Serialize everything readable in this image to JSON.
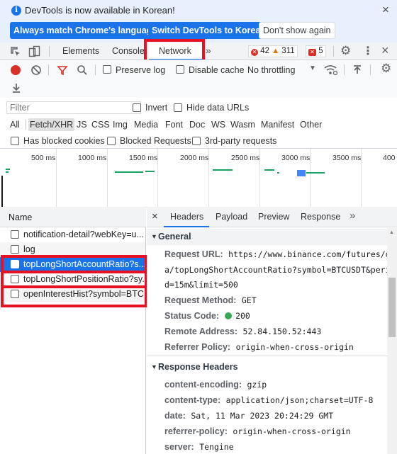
{
  "infobar": {
    "message": "DevTools is now available in Korean!",
    "buttons": [
      "Always match Chrome's language",
      "Switch DevTools to Korean",
      "Don't show again"
    ],
    "close": "×"
  },
  "tabbar": {
    "tabs": [
      "Elements",
      "Console",
      "Network"
    ],
    "more": "»",
    "errors": "42",
    "warnings": "311",
    "issues": "5"
  },
  "toolbar": {
    "preserve_log": "Preserve log",
    "disable_cache": "Disable cache",
    "throttling": "No throttling"
  },
  "filter": {
    "placeholder": "Filter",
    "invert": "Invert",
    "hide_data_urls": "Hide data URLs",
    "types": [
      "All",
      "Fetch/XHR",
      "JS",
      "CSS",
      "Img",
      "Media",
      "Font",
      "Doc",
      "WS",
      "Wasm",
      "Manifest",
      "Other"
    ],
    "has_blocked_cookies": "Has blocked cookies",
    "blocked_requests": "Blocked Requests",
    "third_party": "3rd-party requests"
  },
  "overview": {
    "ticks": [
      "500 ms",
      "1000 ms",
      "1500 ms",
      "2000 ms",
      "2500 ms",
      "3000 ms",
      "3500 ms",
      "400"
    ]
  },
  "requests": {
    "header": "Name",
    "rows": [
      "notification-detail?webKey=u...",
      "log",
      "topLongShortAccountRatio?s...",
      "topLongShortPositionRatio?sy...",
      "openInterestHist?symbol=BTC..."
    ]
  },
  "detail": {
    "close": "×",
    "tabs": [
      "Headers",
      "Payload",
      "Preview",
      "Response"
    ],
    "more": "»",
    "general": {
      "title": "General",
      "request_url_label": "Request URL:",
      "request_url_lines": [
        "https://www.binance.com/futures/dat",
        "a/topLongShortAccountRatio?symbol=BTCUSDT&perio",
        "d=15m&limit=500"
      ],
      "method_label": "Request Method:",
      "method": "GET",
      "status_label": "Status Code:",
      "status": "200",
      "remote_label": "Remote Address:",
      "remote": "52.84.150.52:443",
      "referrer_label": "Referrer Policy:",
      "referrer": "origin-when-cross-origin"
    },
    "response_headers": {
      "title": "Response Headers",
      "items": [
        {
          "k": "content-encoding:",
          "v": "gzip"
        },
        {
          "k": "content-type:",
          "v": "application/json;charset=UTF-8"
        },
        {
          "k": "date:",
          "v": "Sat, 11 Mar 2023 20:24:29 GMT"
        },
        {
          "k": "referrer-policy:",
          "v": "origin-when-cross-origin"
        },
        {
          "k": "server:",
          "v": "Tengine"
        }
      ]
    }
  },
  "colors": {
    "accent": "#1a73e8",
    "highlight_box": "#e81123",
    "selected_row": "#1a73e8",
    "status_ok": "#34a853"
  }
}
